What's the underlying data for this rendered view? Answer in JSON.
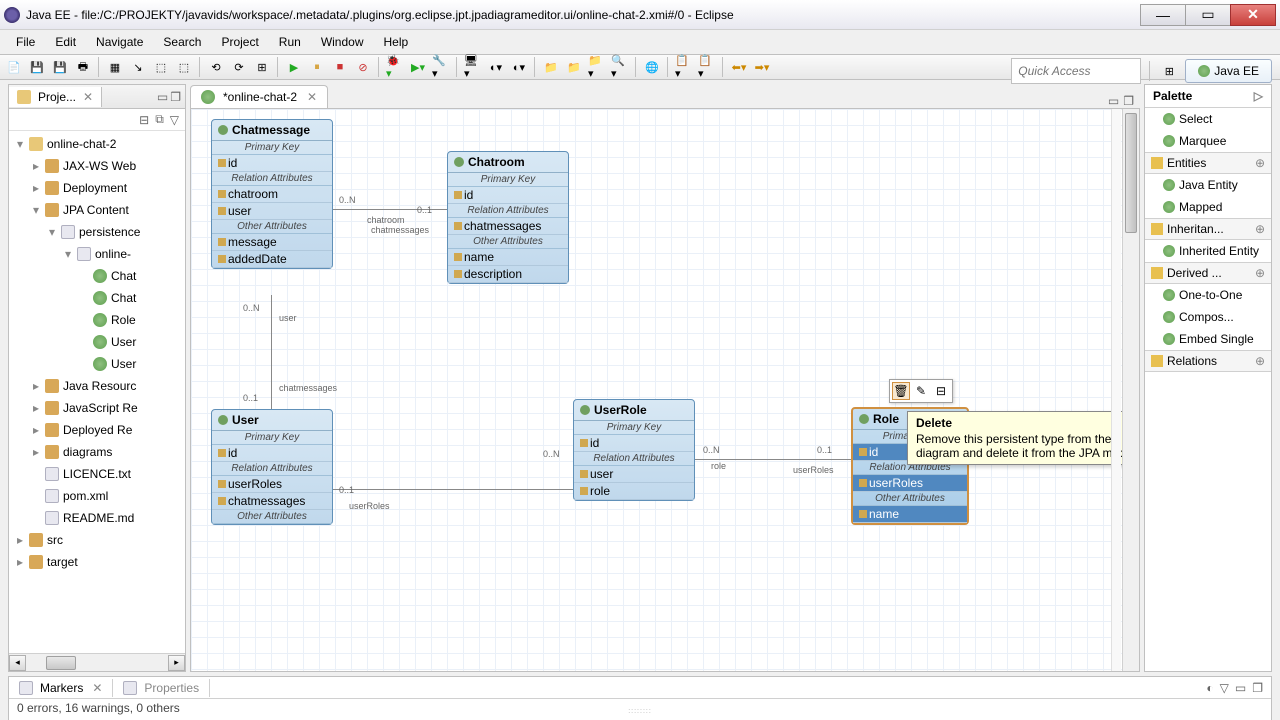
{
  "window": {
    "title": "Java EE - file:/C:/PROJEKTY/javavids/workspace/.metadata/.plugins/org.eclipse.jpt.jpadiagrameditor.ui/online-chat-2.xmi#/0 - Eclipse"
  },
  "menu": [
    "File",
    "Edit",
    "Navigate",
    "Search",
    "Project",
    "Run",
    "Window",
    "Help"
  ],
  "quick_access_placeholder": "Quick Access",
  "perspective_label": "Java EE",
  "project_view": {
    "tab": "Proje...",
    "items": [
      {
        "lvl": 0,
        "tw": "▾",
        "icon": "ti-proj",
        "label": "online-chat-2"
      },
      {
        "lvl": 1,
        "tw": "▸",
        "icon": "ti-pkg",
        "label": "JAX-WS Web"
      },
      {
        "lvl": 1,
        "tw": "▸",
        "icon": "ti-pkg",
        "label": "Deployment"
      },
      {
        "lvl": 1,
        "tw": "▾",
        "icon": "ti-pkg",
        "label": "JPA Content"
      },
      {
        "lvl": 2,
        "tw": "▾",
        "icon": "ti-file",
        "label": "persistence"
      },
      {
        "lvl": 3,
        "tw": "▾",
        "icon": "ti-file",
        "label": "online-"
      },
      {
        "lvl": 4,
        "tw": "",
        "icon": "ti-ent",
        "label": "Chat"
      },
      {
        "lvl": 4,
        "tw": "",
        "icon": "ti-ent",
        "label": "Chat"
      },
      {
        "lvl": 4,
        "tw": "",
        "icon": "ti-ent",
        "label": "Role"
      },
      {
        "lvl": 4,
        "tw": "",
        "icon": "ti-ent",
        "label": "User"
      },
      {
        "lvl": 4,
        "tw": "",
        "icon": "ti-ent",
        "label": "User"
      },
      {
        "lvl": 1,
        "tw": "▸",
        "icon": "ti-pkg",
        "label": "Java Resourc"
      },
      {
        "lvl": 1,
        "tw": "▸",
        "icon": "ti-pkg",
        "label": "JavaScript Re"
      },
      {
        "lvl": 1,
        "tw": "▸",
        "icon": "ti-pkg",
        "label": "Deployed Re"
      },
      {
        "lvl": 1,
        "tw": "▸",
        "icon": "ti-pkg",
        "label": "diagrams"
      },
      {
        "lvl": 1,
        "tw": "",
        "icon": "ti-file",
        "label": "LICENCE.txt"
      },
      {
        "lvl": 1,
        "tw": "",
        "icon": "ti-file",
        "label": "pom.xml"
      },
      {
        "lvl": 1,
        "tw": "",
        "icon": "ti-file",
        "label": "README.md"
      },
      {
        "lvl": 0,
        "tw": "▸",
        "icon": "ti-pkg",
        "label": "src"
      },
      {
        "lvl": 0,
        "tw": "▸",
        "icon": "ti-pkg",
        "label": "target"
      }
    ]
  },
  "editor": {
    "tab": "*online-chat-2"
  },
  "entities": {
    "chatmessage": {
      "title": "Chatmessage",
      "sections": {
        "pk": "Primary Key",
        "rel": "Relation Attributes",
        "other": "Other Attributes"
      },
      "pk": [
        "id"
      ],
      "rel": [
        "chatroom",
        "user"
      ],
      "other": [
        "message",
        "addedDate"
      ]
    },
    "chatroom": {
      "title": "Chatroom",
      "sections": {
        "pk": "Primary Key",
        "rel": "Relation Attributes",
        "other": "Other Attributes"
      },
      "pk": [
        "id"
      ],
      "rel": [
        "chatmessages"
      ],
      "other": [
        "name",
        "description"
      ]
    },
    "user": {
      "title": "User",
      "sections": {
        "pk": "Primary Key",
        "rel": "Relation Attributes",
        "other": "Other Attributes"
      },
      "pk": [
        "id"
      ],
      "rel": [
        "userRoles",
        "chatmessages"
      ],
      "other": ""
    },
    "userrole": {
      "title": "UserRole",
      "sections": {
        "pk": "Primary Key",
        "rel": "Relation Attributes"
      },
      "pk": [
        "id"
      ],
      "rel": [
        "user",
        "role"
      ]
    },
    "role": {
      "title": "Role",
      "sections": {
        "pk": "Primary Key",
        "rel": "Relation Attributes",
        "other": "Other Attributes"
      },
      "pk": [
        "id"
      ],
      "rel": [
        "userRoles"
      ],
      "other": [
        "name"
      ]
    }
  },
  "relations": {
    "cm_cr": {
      "l1": "0..N",
      "l2": "0..1",
      "n1": "chatroom",
      "n2": "chatmessages"
    },
    "cm_u": {
      "l1": "0..N",
      "l2": "0..1",
      "n1": "user",
      "n2": "chatmessages"
    },
    "u_ur": {
      "l1": "0..1",
      "l2": "0..N",
      "n1": "userRoles"
    },
    "ur_r": {
      "l1": "0..N",
      "l2": "0..1",
      "n1": "role",
      "n2": "userRoles"
    }
  },
  "tooltip": {
    "title": "Delete",
    "body": "Remove this persistent type from the diagram and delete it from the JPA model."
  },
  "palette": {
    "title": "Palette",
    "groups": [
      {
        "kind": "item",
        "label": "Select"
      },
      {
        "kind": "item",
        "label": "Marquee"
      },
      {
        "kind": "grp",
        "label": "Entities"
      },
      {
        "kind": "item",
        "label": "Java Entity"
      },
      {
        "kind": "item",
        "label": "Mapped"
      },
      {
        "kind": "grp",
        "label": "Inheritan..."
      },
      {
        "kind": "item",
        "label": "Inherited Entity"
      },
      {
        "kind": "grp",
        "label": "Derived ..."
      },
      {
        "kind": "item",
        "label": "One-to-One"
      },
      {
        "kind": "item",
        "label": "Compos..."
      },
      {
        "kind": "item",
        "label": "Embed Single"
      },
      {
        "kind": "grp",
        "label": "Relations"
      }
    ]
  },
  "bottom": {
    "tabs": [
      "Markers",
      "Properties"
    ],
    "status": "0 errors, 16 warnings, 0 others"
  }
}
